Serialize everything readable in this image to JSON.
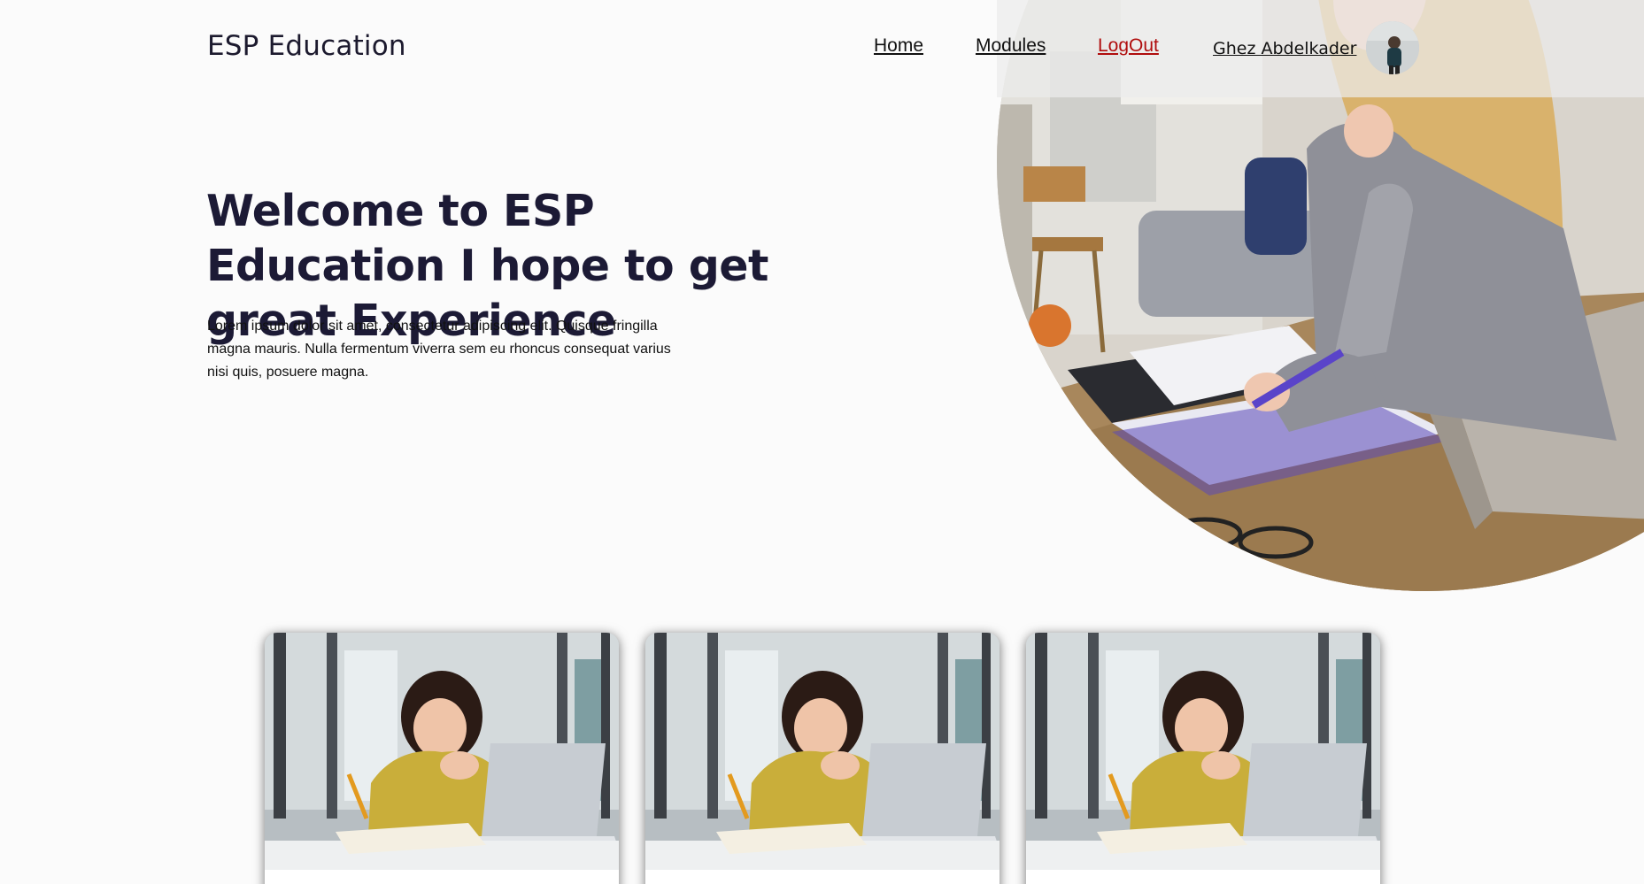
{
  "header": {
    "logo": "ESP Education",
    "nav": [
      {
        "label": "Home"
      },
      {
        "label": "Modules"
      },
      {
        "label": "LogOut"
      }
    ],
    "user_name": "Ghez Abdelkader"
  },
  "hero": {
    "title": "Welcome to ESP Education I hope to get great Experience",
    "text": "Lorem ipsum dolor sit amet, consectetur adipiscing elit. Quisque fringilla magna mauris. Nulla fermentum viverra sem eu rhoncus consequat varius nisi quis, posuere magna."
  },
  "colors": {
    "logout": "#b00d0d",
    "heading": "#1c1a35",
    "background": "#fbfbfb"
  },
  "cards": [
    {
      "image": "student-studying-photo"
    },
    {
      "image": "student-studying-photo"
    },
    {
      "image": "student-studying-photo"
    }
  ]
}
